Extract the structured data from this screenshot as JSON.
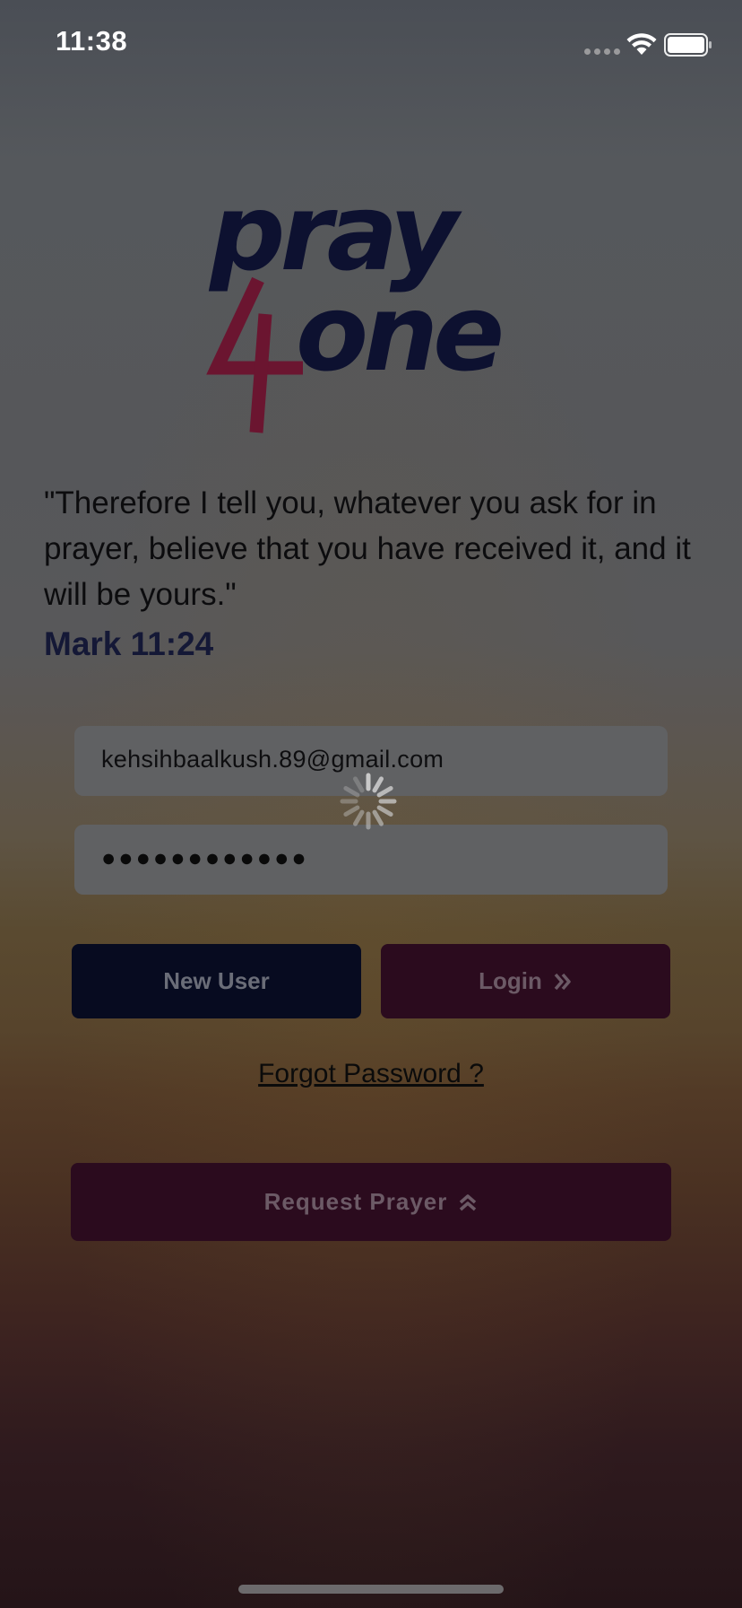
{
  "status_bar": {
    "time": "11:38"
  },
  "logo": {
    "word_top": "pray",
    "word_bottom": "one",
    "numeral": "4",
    "colors": {
      "text": "#0d1130",
      "accent": "#6b1530"
    }
  },
  "quote": {
    "text": "\"Therefore I tell you, whatever you ask for in prayer, believe that you have received it, and it will be yours.\"",
    "reference": "Mark 11:24"
  },
  "login_form": {
    "email_value": "kehsihbaalkush.89@gmail.com",
    "password_value": "●●●●●●●●●●●●",
    "new_user_label": "New User",
    "login_label": "Login",
    "login_icon": "double-chevron-right-icon",
    "forgot_password_label": "Forgot Password ?",
    "request_prayer_label": "Request Prayer",
    "request_prayer_icon": "double-chevron-up-icon"
  },
  "loading": {
    "icon": "activity-spinner-icon"
  },
  "colors": {
    "new_user_button": "#070b20",
    "login_button": "#2b0b1e",
    "input_background": "#606163"
  }
}
